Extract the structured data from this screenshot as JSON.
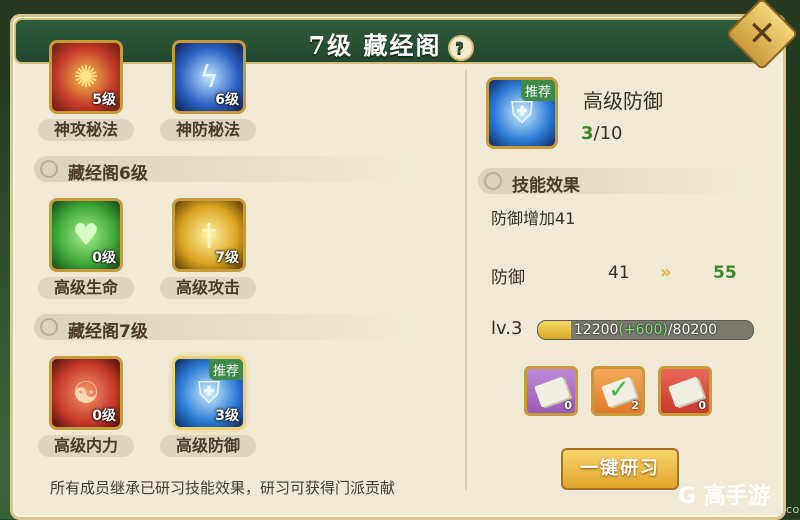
{
  "header": {
    "title": "7级 藏经阁",
    "help_glyph": "?",
    "close_glyph": "✕"
  },
  "left": {
    "rows": [
      {
        "section": null,
        "skills": [
          {
            "name": "神攻秘法",
            "level": "5级",
            "icon": "attack-aura-icon",
            "color": "#c33a2a"
          },
          {
            "name": "神防秘法",
            "level": "6级",
            "icon": "lightning-shield-icon",
            "color": "#2a5fc3"
          }
        ]
      },
      {
        "section": "藏经阁6级",
        "skills": [
          {
            "name": "高级生命",
            "level": "0级",
            "icon": "heart-heal-icon",
            "color": "#3fa83a"
          },
          {
            "name": "高级攻击",
            "level": "7级",
            "icon": "sword-icon",
            "color": "#d9a41e"
          }
        ]
      },
      {
        "section": "藏经阁7级",
        "skills": [
          {
            "name": "高级内力",
            "level": "0级",
            "icon": "meditation-icon",
            "color": "#c8392b"
          },
          {
            "name": "高级防御",
            "level": "3级",
            "icon": "shield-icon",
            "color": "#2b7bd6",
            "badge": "推荐"
          }
        ]
      }
    ],
    "note": "所有成员继承已研习技能效果，研习可获得门派贡献"
  },
  "right": {
    "skill": {
      "name": "高级防御",
      "badge": "推荐",
      "progress_current": "3",
      "progress_max": "/10"
    },
    "effect_section": "技能效果",
    "effect_text": "防御增加41",
    "stat": {
      "label": "防御",
      "old": "41",
      "arrow": "»",
      "new": "55"
    },
    "level": {
      "label": "lv.3",
      "current": "12200",
      "gain": "(+600)",
      "max": "/80200",
      "fraction": 0.152
    },
    "items": [
      {
        "count": "0",
        "color": "#9a5ab8",
        "icon": "scroll-purple-icon"
      },
      {
        "count": "2",
        "color": "#e07a2a",
        "icon": "scroll-orange-icon"
      },
      {
        "count": "0",
        "color": "#c8392b",
        "icon": "scroll-red-icon"
      }
    ],
    "study_button": "一键研习"
  },
  "watermark": {
    "brand": "G 高手游",
    "site": "GAOSHOUYOU.COM"
  }
}
